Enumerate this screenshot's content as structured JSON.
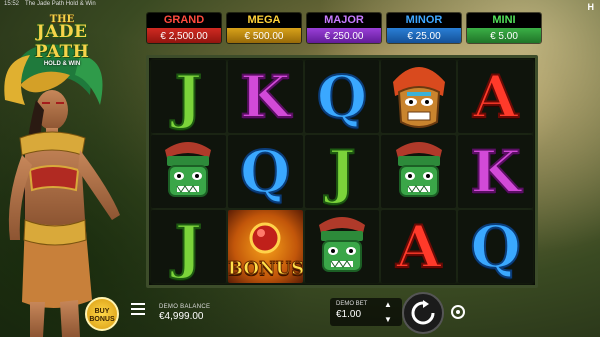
{
  "topbar": {
    "time": "15:52",
    "title": "The Jade Path Hold & Win",
    "menu": "H"
  },
  "logo": {
    "line1": "THE",
    "line2": "JADE PATH",
    "line3": "HOLD & WIN"
  },
  "jackpots": [
    {
      "name": "GRAND",
      "value": "€ 2,500.00"
    },
    {
      "name": "MEGA",
      "value": "€ 500.00"
    },
    {
      "name": "MAJOR",
      "value": "€ 250.00"
    },
    {
      "name": "MINOR",
      "value": "€ 25.00"
    },
    {
      "name": "MINI",
      "value": "€ 5.00"
    }
  ],
  "reels": [
    [
      "J",
      "mask",
      "J"
    ],
    [
      "K",
      "Q",
      "bonus"
    ],
    [
      "Q",
      "J",
      "mask"
    ],
    [
      "tiki",
      "mask",
      "A"
    ],
    [
      "A",
      "K",
      "Q"
    ]
  ],
  "bonus_label": "BONUS",
  "buy_bonus": {
    "line1": "BUY",
    "line2": "BONUS"
  },
  "balance": {
    "label": "DEMO BALANCE",
    "value": "€4,999.00"
  },
  "bet": {
    "label": "DEMO BET",
    "value": "€1.00"
  },
  "colors": {
    "grand": "#ff4b3e",
    "mega": "#ffd23a",
    "major": "#c77bff",
    "minor": "#3fa7ff",
    "mini": "#53e05b"
  }
}
